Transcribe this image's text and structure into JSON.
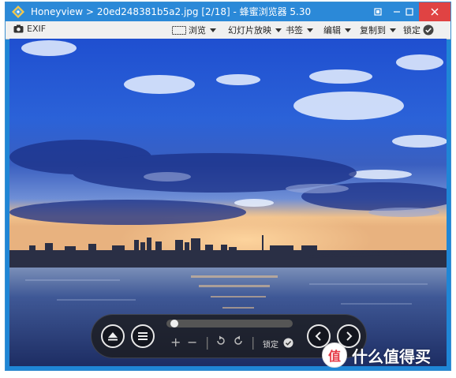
{
  "window": {
    "title": "20ed248381b5a2.jpg [2/18] - 蜂蜜浏览器 5.30",
    "app_name": "Honeyview",
    "separator": ">"
  },
  "toolbar": {
    "exif_label": "EXIF",
    "browse_label": "浏览",
    "slideshow_label": "幻灯片放映",
    "bookmark_label": "书签",
    "edit_label": "编辑",
    "copy_to_label": "复制到",
    "lock_label": "锁定"
  },
  "controls": {
    "lock_label": "锁定",
    "seek_progress": 0.02
  },
  "watermark": {
    "badge": "值",
    "text": "什么值得买"
  },
  "colors": {
    "titlebar": "#2b89d8",
    "close_button": "#e04343",
    "toolbar": "#f0f0f0"
  }
}
